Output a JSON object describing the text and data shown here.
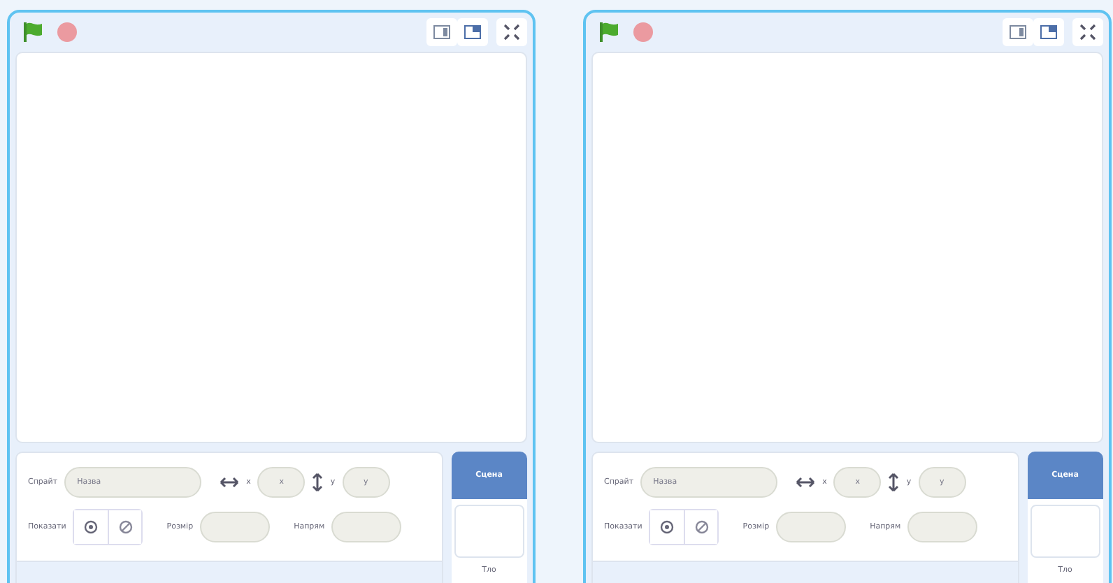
{
  "panels": [
    {
      "sprite_info": {
        "sprite_label": "Спрайт",
        "name_field": {
          "placeholder": "Назва"
        },
        "x_label": "x",
        "x_field": {
          "placeholder": "x"
        },
        "y_label": "y",
        "y_field": {
          "placeholder": "y"
        },
        "show_label": "Показати",
        "size_label": "Розмір",
        "direction_label": "Напрям"
      },
      "stage_selector": {
        "title": "Сцена",
        "backdrops_label": "Тло"
      }
    },
    {
      "sprite_info": {
        "sprite_label": "Спрайт",
        "name_field": {
          "placeholder": "Назва"
        },
        "x_label": "x",
        "x_field": {
          "placeholder": "x"
        },
        "y_label": "y",
        "y_field": {
          "placeholder": "y"
        },
        "show_label": "Показати",
        "size_label": "Розмір",
        "direction_label": "Напрям"
      },
      "stage_selector": {
        "title": "Сцена",
        "backdrops_label": "Тло"
      }
    }
  ]
}
